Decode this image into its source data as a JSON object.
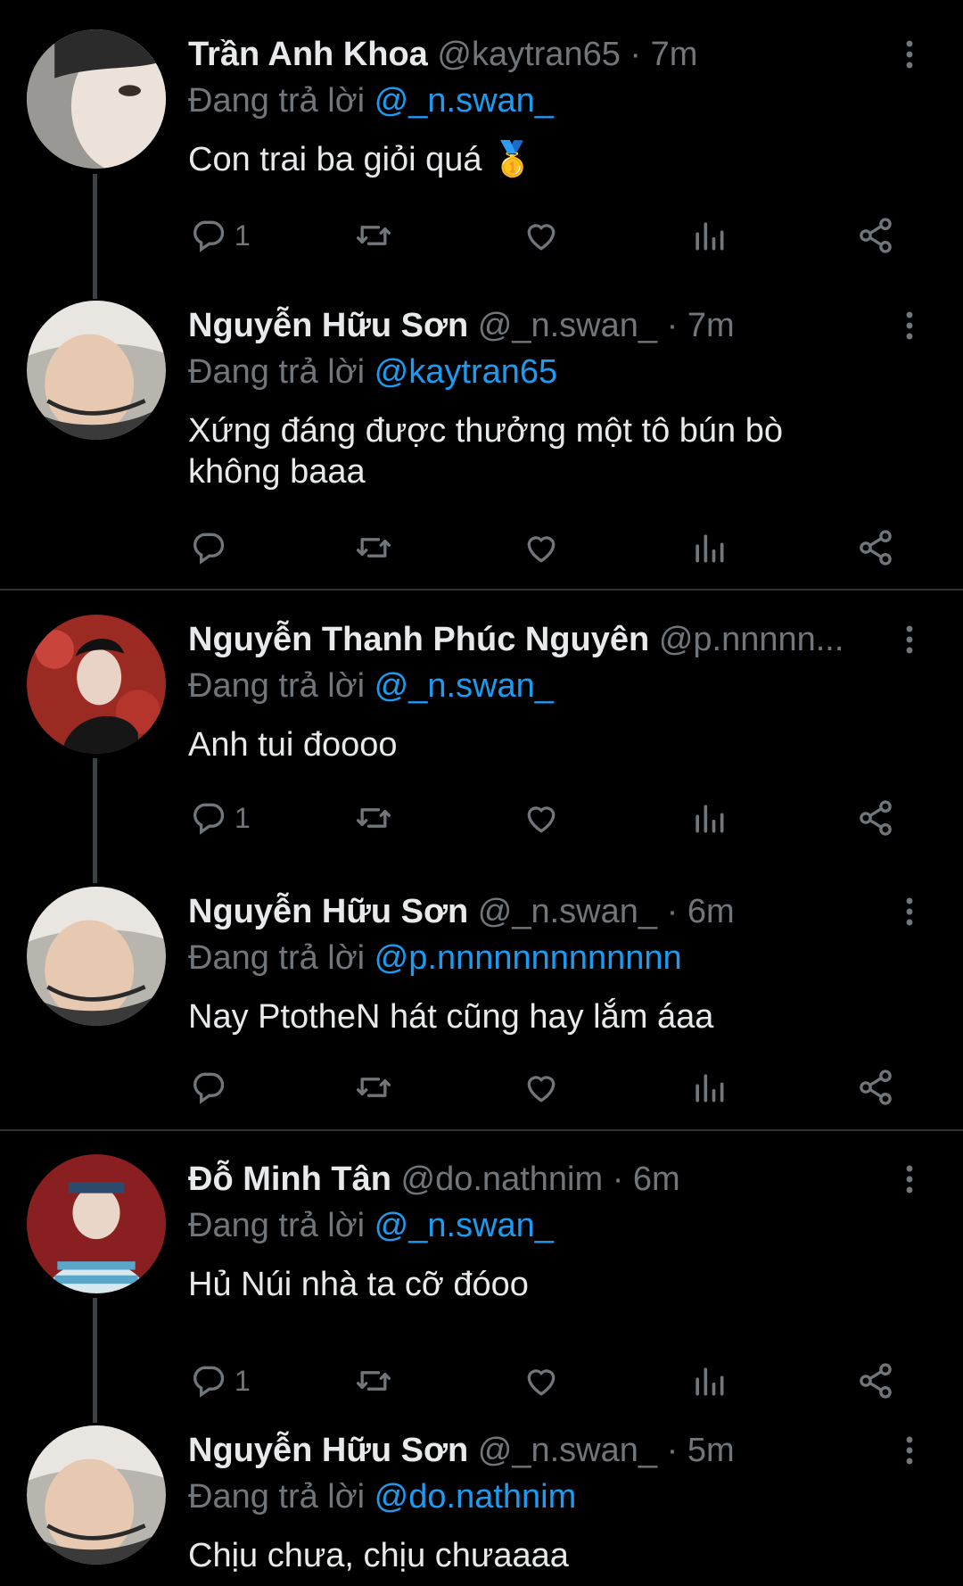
{
  "replying_label": "Đang trả lời",
  "tweets": [
    {
      "name": "Trần Anh Khoa",
      "handle": "@kaytran65",
      "sep": "·",
      "time": "7m",
      "mention": "@_n.swan_",
      "text": "Con trai ba giỏi quá 🥇",
      "reply_count": "1"
    },
    {
      "name": "Nguyễn Hữu Sơn",
      "handle": "@_n.swan_",
      "sep": "·",
      "time": "7m",
      "mention": "@kaytran65",
      "text": "Xứng đáng được thưởng một tô bún bò không baaa",
      "reply_count": ""
    },
    {
      "name": "Nguyễn Thanh Phúc Nguyên",
      "handle": "@p.nnnnn...",
      "sep": "",
      "time": "",
      "mention": "@_n.swan_",
      "text": "Anh tui đoooo",
      "reply_count": "1"
    },
    {
      "name": "Nguyễn Hữu Sơn",
      "handle": "@_n.swan_",
      "sep": "·",
      "time": "6m",
      "mention": "@p.nnnnnnnnnnnnn",
      "text": "Nay PtotheN hát cũng hay lắm áaa",
      "reply_count": ""
    },
    {
      "name": "Đỗ Minh Tân",
      "handle": "@do.nathnim",
      "sep": "·",
      "time": "6m",
      "mention": "@_n.swan_",
      "text": "Hủ Núi nhà ta cỡ đóoo",
      "reply_count": "1"
    },
    {
      "name": "Nguyễn Hữu Sơn",
      "handle": "@_n.swan_",
      "sep": "·",
      "time": "5m",
      "mention": "@do.nathnim",
      "text": "Chịu chưa, chịu chưaaaa",
      "reply_count": ""
    }
  ],
  "icons": {
    "reply": "reply-icon",
    "retweet": "retweet-icon",
    "like": "like-icon",
    "views": "views-icon",
    "share": "share-icon",
    "more": "more-vertical-icon"
  },
  "colors": {
    "background": "#000000",
    "text": "#e7e9ea",
    "muted": "#71767b",
    "link": "#1d9bf0"
  }
}
